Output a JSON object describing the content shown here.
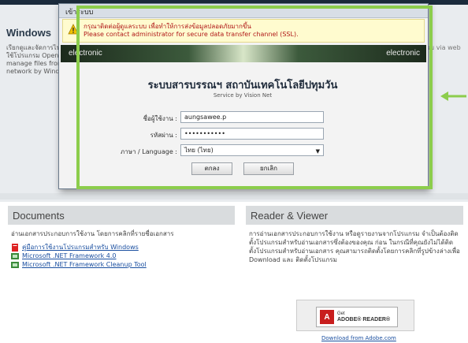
{
  "background": {
    "windows_heading": "Windows",
    "left_snippet": "เรียกดูและจัดการไฟล์ โดยใช้โปรแกรม Open and manage files from network by Windows",
    "right_snippet": "ไปร่วม via web",
    "documents": {
      "heading": "Documents",
      "intro": "อ่านเอกสารประกอบการใช้งาน โดยการคลิกที่รายชื่อเอกสาร",
      "links": [
        "คู่มือการใช้งานโปรแกรมสำหรับ Windows",
        "Microsoft .NET Framework 4.0",
        "Microsoft .NET Framework Cleanup Tool"
      ]
    },
    "reader": {
      "heading": "Reader & Viewer",
      "text": "การอ่านเอกสารประกอบการใช้งาน หรือดูรายงานจากโปรแกรม จำเป็นต้องติดตั้งโปรแกรมสำหรับอ่านเอกสารซึ่งต้องของคุณ ก่อน ในกรณีที่คุณยังไม่ได้ติดตั้งโปรแกรมสำหรับอ่านเอกสาร คุณสามารถติดตั้งโดยการคลิกที่รูปข้างล่างเพื่อ Download และ ติดตั้งโปรแกรม",
      "badge_get": "Get",
      "badge_name": "ADOBE® READER®",
      "download_link": "Download from Adobe.com"
    }
  },
  "dialog": {
    "title": "เข้าระบบ",
    "warning_line1": "กรุณาติดต่อผู้ดูแลระบบ เพื่อทำให้การส่งข้อมูลปลอดภัยมากขึ้น",
    "warning_line2": "Please contact administrator for secure data transfer channel (SSL).",
    "banner_left": "electronic",
    "banner_right": "electronic",
    "system_title": "ระบบสารบรรณฯ สถาบันเทคโนโลยีปทุมวัน",
    "system_subtitle": "Service by Vision Net",
    "username_label": "ชื่อผู้ใช้งาน :",
    "username_value": "aungsawee.p",
    "password_label": "รหัสผ่าน :",
    "password_value": "•••••••••••",
    "language_label": "ภาษา / Language :",
    "language_value": "ไทย (ไทย)",
    "ok_button": "ตกลง",
    "cancel_button": "ยกเลิก"
  },
  "colors": {
    "highlight": "#8ccd4c",
    "warning_text": "#b01818",
    "link": "#1a4fa0"
  }
}
